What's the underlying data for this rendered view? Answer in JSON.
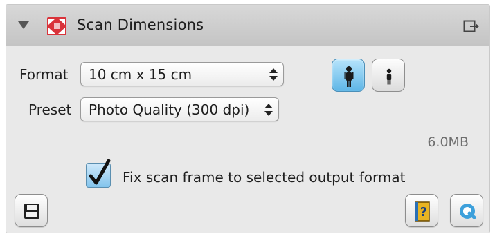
{
  "panel": {
    "title": "Scan Dimensions",
    "icons": {
      "disclosure": "disclosure-triangle-icon",
      "app": "scan-frame-icon",
      "detach": "detach-panel-icon"
    }
  },
  "format": {
    "label": "Format",
    "value": "10 cm x 15 cm"
  },
  "preset": {
    "label": "Preset",
    "value": "Photo Quality (300 dpi)"
  },
  "orientation": {
    "options": [
      "portrait",
      "landscape"
    ],
    "selected": "portrait"
  },
  "file_size": "6.0MB",
  "fix_frame": {
    "label": "Fix scan frame to selected output format",
    "checked": true
  },
  "toolbar": {
    "save_icon": "floppy-disk-icon",
    "help_icon": "help-book-icon",
    "zoom_icon": "magnifier-icon"
  },
  "colors": {
    "accent": "#5eb6e6",
    "panel_bg": "#e9e9e9",
    "header_bg": "#c4c4c4",
    "app_icon_red": "#d9333a"
  }
}
